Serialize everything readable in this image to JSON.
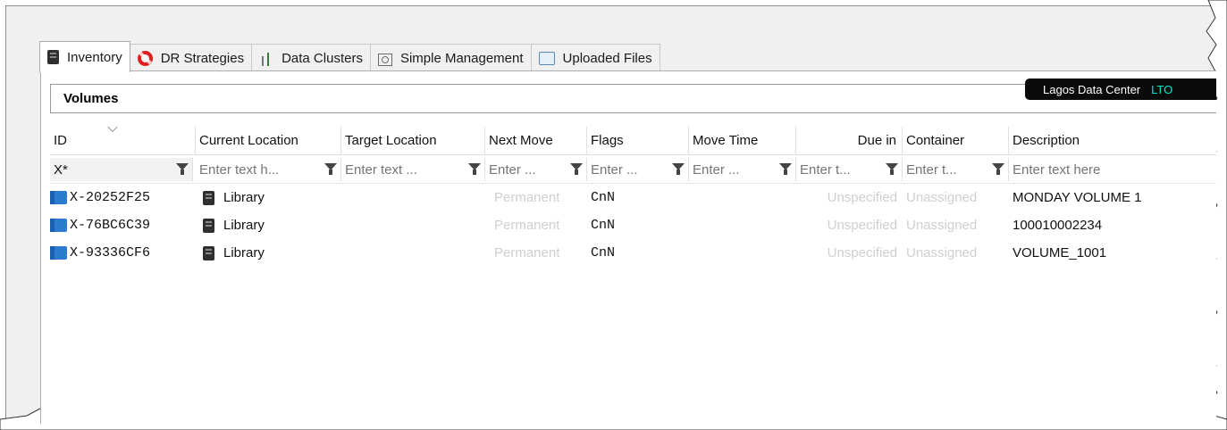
{
  "tabs": [
    {
      "label": "Inventory",
      "icon": "inventory-icon",
      "active": true
    },
    {
      "label": "DR Strategies",
      "icon": "lifebuoy-icon",
      "active": false
    },
    {
      "label": "Data Clusters",
      "icon": "data-clusters-icon",
      "active": false
    },
    {
      "label": "Simple Management",
      "icon": "simple-management-icon",
      "active": false
    },
    {
      "label": "Uploaded Files",
      "icon": "uploaded-files-icon",
      "active": false
    }
  ],
  "panel": {
    "title": "Volumes",
    "location": {
      "name": "Lagos Data Center",
      "tag": "LTO"
    }
  },
  "columns": [
    {
      "label": "ID",
      "filter_value": "X*",
      "filter_placeholder": ""
    },
    {
      "label": "Current Location",
      "filter_value": "",
      "filter_placeholder": "Enter text h..."
    },
    {
      "label": "Target Location",
      "filter_value": "",
      "filter_placeholder": "Enter text ..."
    },
    {
      "label": "Next Move",
      "filter_value": "",
      "filter_placeholder": "Enter ..."
    },
    {
      "label": "Flags",
      "filter_value": "",
      "filter_placeholder": "Enter ..."
    },
    {
      "label": "Move Time",
      "filter_value": "",
      "filter_placeholder": "Enter ..."
    },
    {
      "label": "Due in",
      "filter_value": "",
      "filter_placeholder": "Enter t..."
    },
    {
      "label": "Container",
      "filter_value": "",
      "filter_placeholder": "Enter t..."
    },
    {
      "label": "Description",
      "filter_value": "",
      "filter_placeholder": "Enter text here"
    }
  ],
  "rows": [
    {
      "id": "X-20252F25",
      "current_location": "Library",
      "target_location": "",
      "next_move": "Permanent",
      "flags": "CnN",
      "move_time": "",
      "due_in": "Unspecified",
      "container": "Unassigned",
      "description": "MONDAY VOLUME 1"
    },
    {
      "id": "X-76BC6C39",
      "current_location": "Library",
      "target_location": "",
      "next_move": "Permanent",
      "flags": "CnN",
      "move_time": "",
      "due_in": "Unspecified",
      "container": "Unassigned",
      "description": "100010002234"
    },
    {
      "id": "X-93336CF6",
      "current_location": "Library",
      "target_location": "",
      "next_move": "Permanent",
      "flags": "CnN",
      "move_time": "",
      "due_in": "Unspecified",
      "container": "Unassigned",
      "description": "VOLUME_1001"
    }
  ],
  "colors": {
    "tape": "#2c7bd1",
    "location_tag": "#00e5d0",
    "muted": "#cfcfcf",
    "filter_icon": "#444444"
  }
}
